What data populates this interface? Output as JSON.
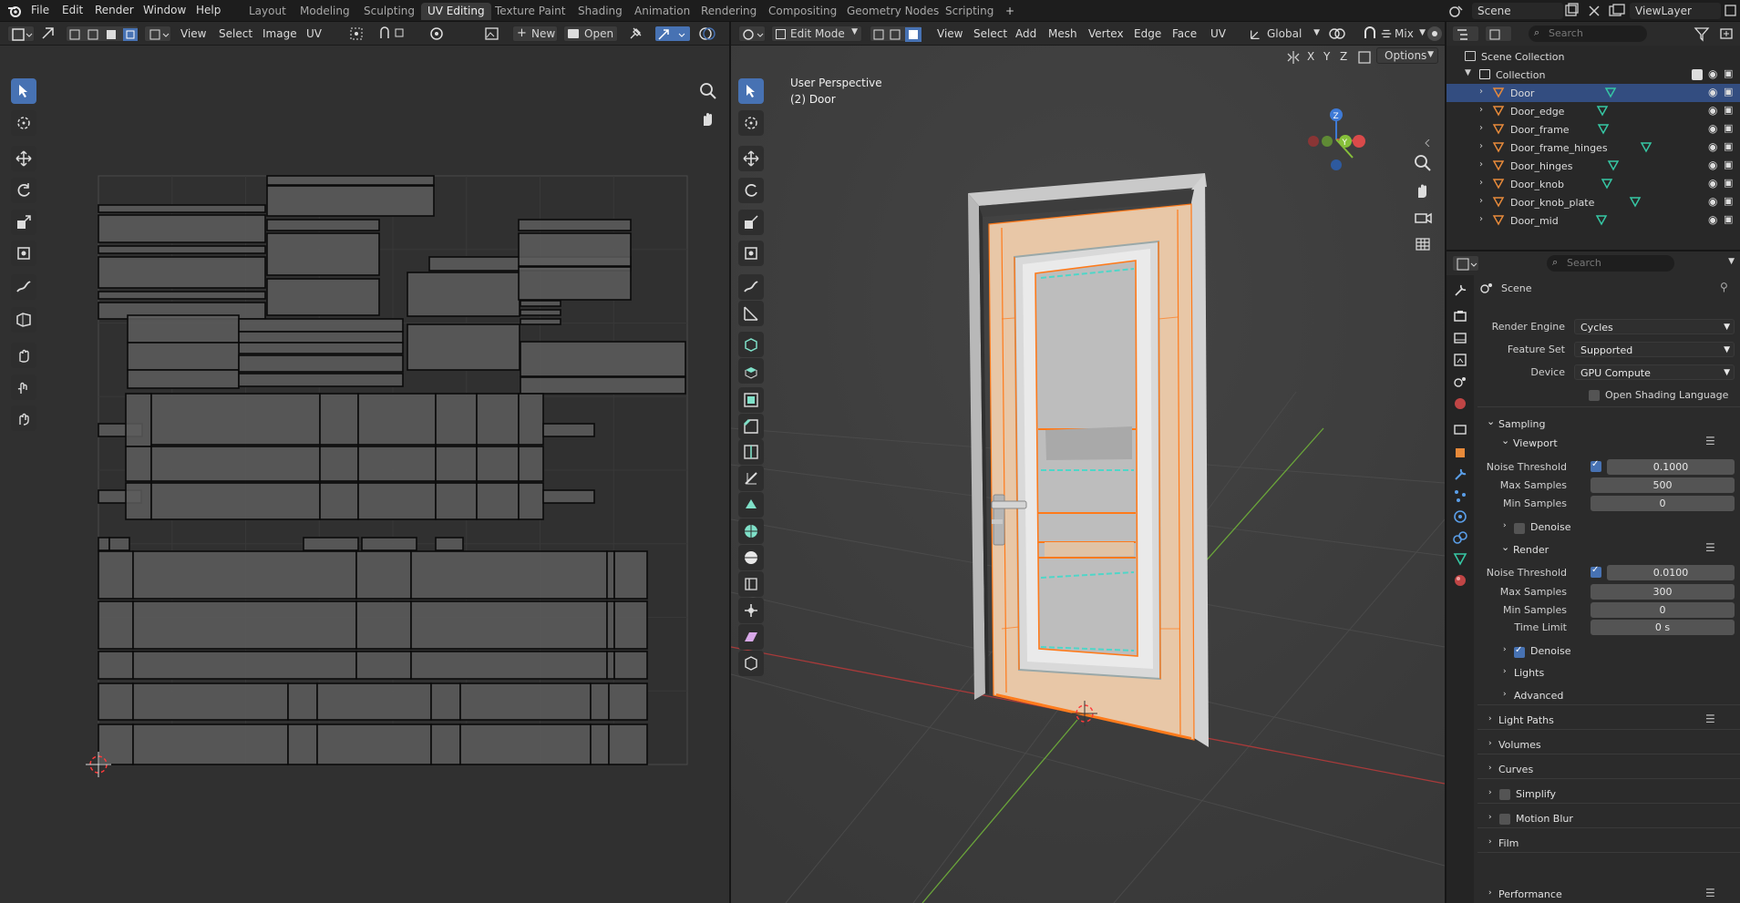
{
  "topbar": {
    "menus": [
      "File",
      "Edit",
      "Render",
      "Window",
      "Help"
    ],
    "workspaces": [
      "Layout",
      "Modeling",
      "Sculpting",
      "UV Editing",
      "Texture Paint",
      "Shading",
      "Animation",
      "Rendering",
      "Compositing",
      "Geometry Nodes",
      "Scripting"
    ],
    "active_workspace": "UV Editing",
    "add_tab": "+",
    "scene_name": "Scene",
    "viewlayer_name": "ViewLayer"
  },
  "uv_header": {
    "menus": [
      "View",
      "Select",
      "Image",
      "UV"
    ],
    "new_label": "New",
    "open_label": "Open"
  },
  "vp_header": {
    "mode": "Edit Mode",
    "menus": [
      "View",
      "Select",
      "Add",
      "Mesh",
      "Vertex",
      "Edge",
      "Face",
      "UV"
    ],
    "transform_orientation": "Global",
    "shading_mix": "Mix",
    "axes": [
      "X",
      "Y",
      "Z"
    ],
    "options_label": "Options"
  },
  "viewport": {
    "perspective_label": "User Perspective",
    "object_label": "(2) Door"
  },
  "outliner": {
    "search_placeholder": "Search",
    "root": "Scene Collection",
    "collection": "Collection",
    "items": [
      "Door",
      "Door_edge",
      "Door_frame",
      "Door_frame_hinges",
      "Door_hinges",
      "Door_knob",
      "Door_knob_plate",
      "Door_mid"
    ],
    "selected": "Door"
  },
  "properties": {
    "search_placeholder": "Search",
    "context": "Scene",
    "render_engine_label": "Render Engine",
    "render_engine": "Cycles",
    "feature_set_label": "Feature Set",
    "feature_set": "Supported",
    "device_label": "Device",
    "device": "GPU Compute",
    "osl_label": "Open Shading Language",
    "sampling": "Sampling",
    "viewport": "Viewport",
    "vp_noise_label": "Noise Threshold",
    "vp_noise": "0.1000",
    "vp_max_label": "Max Samples",
    "vp_max": "500",
    "vp_min_label": "Min Samples",
    "vp_min": "0",
    "vp_denoise": "Denoise",
    "render": "Render",
    "r_noise_label": "Noise Threshold",
    "r_noise": "0.0100",
    "r_max_label": "Max Samples",
    "r_max": "300",
    "r_min_label": "Min Samples",
    "r_min": "0",
    "r_time_label": "Time Limit",
    "r_time": "0 s",
    "r_denoise": "Denoise",
    "lights": "Lights",
    "advanced": "Advanced",
    "light_paths": "Light Paths",
    "volumes": "Volumes",
    "curves": "Curves",
    "simplify": "Simplify",
    "motion_blur": "Motion Blur",
    "film": "Film",
    "performance": "Performance"
  },
  "colors": {
    "accent": "#4772b3",
    "selection_orange": "#ff7a1a",
    "seam_teal": "#4fd6c8",
    "mesh_icon": "#36c7a4"
  }
}
